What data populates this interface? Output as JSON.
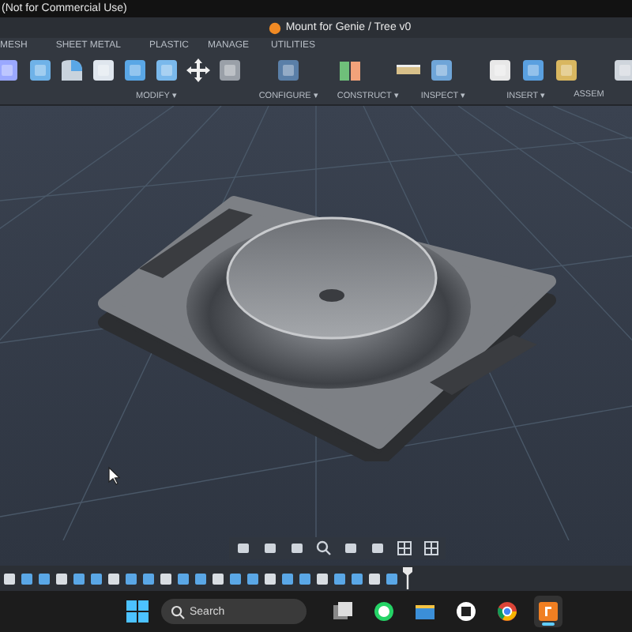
{
  "window": {
    "title": "(Not for Commercial Use)"
  },
  "document": {
    "title": "Mount for Genie / Tree v0"
  },
  "tabs": [
    {
      "label": "MESH"
    },
    {
      "label": "SHEET METAL"
    },
    {
      "label": "PLASTIC"
    },
    {
      "label": "MANAGE"
    },
    {
      "label": "UTILITIES"
    }
  ],
  "groups": [
    {
      "label": "MODIFY ▾"
    },
    {
      "label": "CONFIGURE ▾"
    },
    {
      "label": "CONSTRUCT ▾"
    },
    {
      "label": "INSPECT ▾"
    },
    {
      "label": "INSERT ▾"
    },
    {
      "label": "ASSEM"
    }
  ],
  "taskbar": {
    "search": {
      "placeholder": "Search"
    },
    "apps": [
      {
        "kind": "task-view",
        "selected": false
      },
      {
        "kind": "chat",
        "selected": false
      },
      {
        "kind": "folder",
        "selected": false
      },
      {
        "kind": "camera",
        "selected": false
      },
      {
        "kind": "browser",
        "selected": false
      },
      {
        "kind": "cad",
        "selected": true
      }
    ]
  }
}
